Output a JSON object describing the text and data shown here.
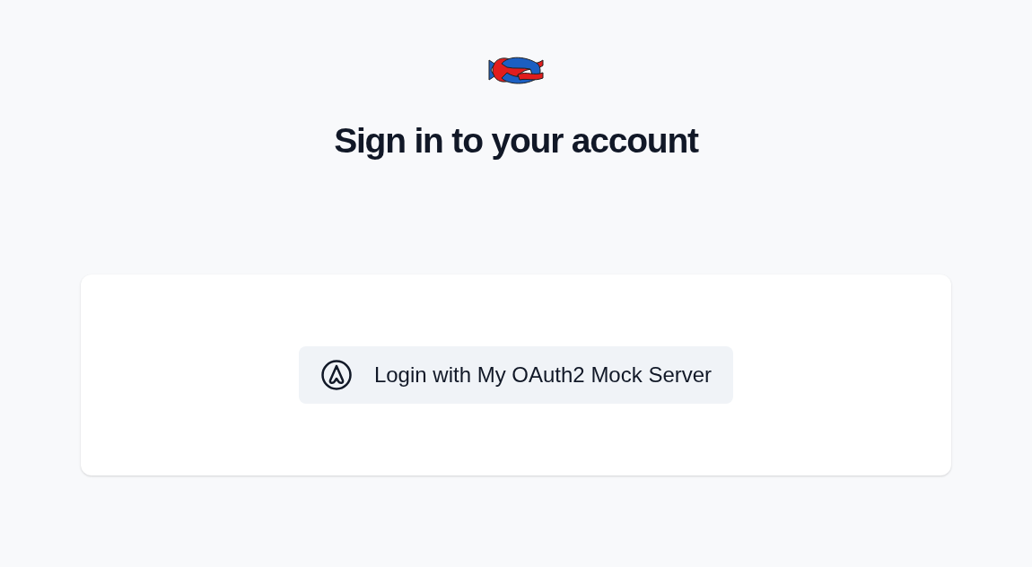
{
  "heading": "Sign in to your account",
  "login_buttons": [
    {
      "label": "Login with My OAuth2 Mock Server"
    }
  ]
}
